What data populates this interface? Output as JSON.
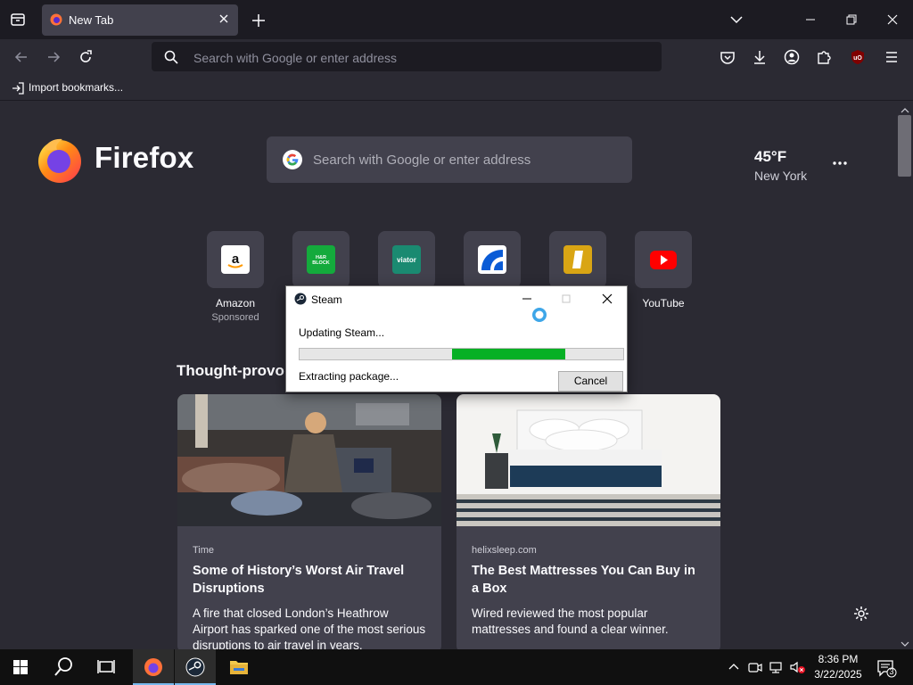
{
  "browser": {
    "tab_title": "New Tab",
    "url_placeholder": "Search with Google or enter address",
    "bookmark_import_label": "Import bookmarks..."
  },
  "newtab": {
    "brand": "Firefox",
    "search_placeholder": "Search with Google or enter address",
    "weather": {
      "temp": "45°F",
      "city": "New York"
    },
    "shortcuts": [
      {
        "label": "Amazon",
        "sub": "Sponsored",
        "icon": "amazon-icon"
      },
      {
        "label": "",
        "sub": "",
        "icon": "hrblock-icon",
        "icon_text": "H&R BLOCK"
      },
      {
        "label": "",
        "sub": "",
        "icon": "viator-icon",
        "icon_text": "viator"
      },
      {
        "label": "",
        "sub": "",
        "icon": "site-icon-blue"
      },
      {
        "label": "",
        "sub": "",
        "icon": "site-icon-gold"
      },
      {
        "label": "YouTube",
        "sub": "",
        "icon": "youtube-icon"
      }
    ],
    "section_heading": "Thought-provol",
    "cards": [
      {
        "source": "Time",
        "title": "Some of History’s Worst Air Travel Disruptions",
        "desc": "A fire that closed London’s Heathrow Airport has sparked one of the most serious disruptions to air travel in years."
      },
      {
        "source": "helixsleep.com",
        "title": "The Best Mattresses You Can Buy in a Box",
        "desc": "Wired reviewed the most popular mattresses and found a clear winner."
      }
    ]
  },
  "dialog": {
    "title": "Steam",
    "message": "Updating Steam...",
    "status": "Extracting package...",
    "progress_start": 0.47,
    "progress_end": 0.82,
    "cancel_label": "Cancel"
  },
  "taskbar": {
    "time": "8:36 PM",
    "date": "3/22/2025",
    "notification_count": "3"
  },
  "colors": {
    "accent": "#0060df",
    "progress": "#06b025"
  }
}
